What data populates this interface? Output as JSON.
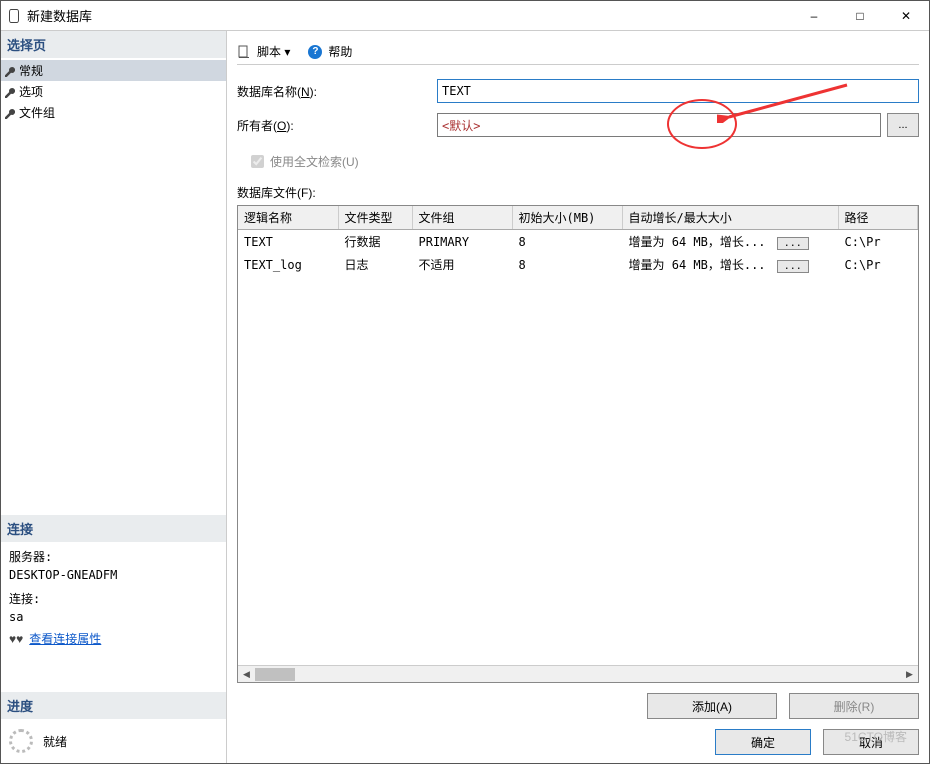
{
  "window": {
    "title": "新建数据库"
  },
  "sidebar": {
    "select_page": "选择页",
    "items": [
      {
        "label": "常规"
      },
      {
        "label": "选项"
      },
      {
        "label": "文件组"
      }
    ],
    "connection": {
      "title": "连接",
      "server_label": "服务器:",
      "server_value": "DESKTOP-GNEADFM",
      "conn_label": "连接:",
      "conn_value": "sa",
      "view_props": "查看连接属性"
    },
    "progress": {
      "title": "进度",
      "status": "就绪"
    }
  },
  "toolbar": {
    "script": "脚本",
    "help": "帮助"
  },
  "form": {
    "dbname_label": "数据库名称(",
    "dbname_key": "N",
    "dbname_label_after": "):",
    "dbname_value": "TEXT",
    "owner_label": "所有者(",
    "owner_key": "O",
    "owner_label_after": "):",
    "owner_value": "<默认>",
    "browse": "...",
    "fulltext_label": "使用全文检索(",
    "fulltext_key": "U",
    "fulltext_label_after": ")",
    "files_label": "数据库文件(",
    "files_key": "F",
    "files_label_after": "):"
  },
  "table": {
    "headers": {
      "logical_name": "逻辑名称",
      "file_type": "文件类型",
      "file_group": "文件组",
      "initial_size": "初始大小(MB)",
      "autogrowth": "自动增长/最大大小",
      "path": "路径"
    },
    "rows": [
      {
        "logical_name": "TEXT",
        "file_type": "行数据",
        "file_group": "PRIMARY",
        "initial_size": "8",
        "autogrowth": "增量为 64 MB，增长...",
        "path": "C:\\Pr"
      },
      {
        "logical_name": "TEXT_log",
        "file_type": "日志",
        "file_group": "不适用",
        "initial_size": "8",
        "autogrowth": "增量为 64 MB，增长...",
        "path": "C:\\Pr"
      }
    ],
    "cell_btn": "..."
  },
  "actions": {
    "add": "添加(A)",
    "remove": "删除(R)"
  },
  "footer": {
    "ok": "确定",
    "cancel": "取消"
  },
  "watermark": "51CTO博客"
}
